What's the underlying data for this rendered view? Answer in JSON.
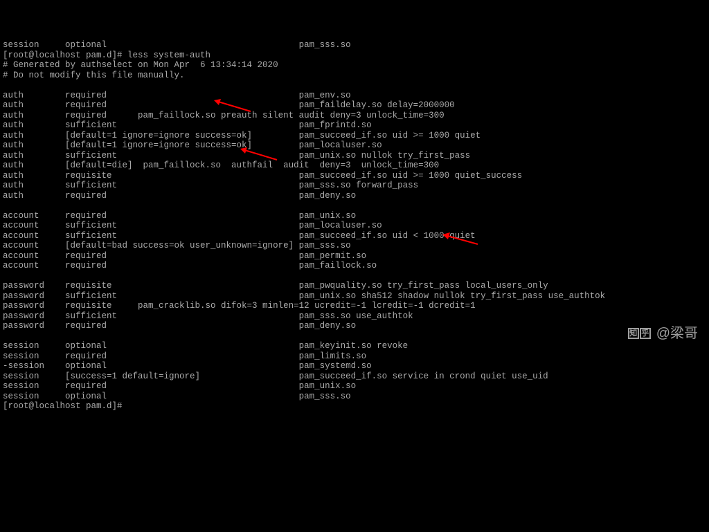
{
  "lines": [
    "session     optional                                     pam_sss.so",
    "[root@localhost pam.d]# less system-auth",
    "# Generated by authselect on Mon Apr  6 13:34:14 2020",
    "# Do not modify this file manually.",
    "",
    "auth        required                                     pam_env.so",
    "auth        required                                     pam_faildelay.so delay=2000000",
    "auth        required      pam_faillock.so preauth silent audit deny=3 unlock_time=300",
    "auth        sufficient                                   pam_fprintd.so",
    "auth        [default=1 ignore=ignore success=ok]         pam_succeed_if.so uid >= 1000 quiet",
    "auth        [default=1 ignore=ignore success=ok]         pam_localuser.so",
    "auth        sufficient                                   pam_unix.so nullok try_first_pass",
    "auth        [default=die]  pam_faillock.so  authfail  audit  deny=3  unlock_time=300",
    "auth        requisite                                    pam_succeed_if.so uid >= 1000 quiet_success",
    "auth        sufficient                                   pam_sss.so forward_pass",
    "auth        required                                     pam_deny.so",
    "",
    "account     required                                     pam_unix.so",
    "account     sufficient                                   pam_localuser.so",
    "account     sufficient                                   pam_succeed_if.so uid < 1000 quiet",
    "account     [default=bad success=ok user_unknown=ignore] pam_sss.so",
    "account     required                                     pam_permit.so",
    "account     required                                     pam_faillock.so",
    "",
    "password    requisite                                    pam_pwquality.so try_first_pass local_users_only",
    "password    sufficient                                   pam_unix.so sha512 shadow nullok try_first_pass use_authtok",
    "password    requisite     pam_cracklib.so difok=3 minlen=12 ucredit=-1 lcredit=-1 dcredit=1",
    "password    sufficient                                   pam_sss.so use_authtok",
    "password    required                                     pam_deny.so",
    "",
    "session     optional                                     pam_keyinit.so revoke",
    "session     required                                     pam_limits.so",
    "-session    optional                                     pam_systemd.so",
    "session     [success=1 default=ignore]                   pam_succeed_if.so service in crond quiet use_uid",
    "session     required                                     pam_unix.so",
    "session     optional                                     pam_sss.so",
    "[root@localhost pam.d]#"
  ],
  "watermark": {
    "logo": "知乎",
    "author": "@梁哥"
  },
  "annotations": {
    "arrow1_target": "pam_faillock.so preauth line",
    "arrow2_target": "pam_faillock.so authfail line",
    "arrow3_target": "account pam_faillock.so line"
  }
}
